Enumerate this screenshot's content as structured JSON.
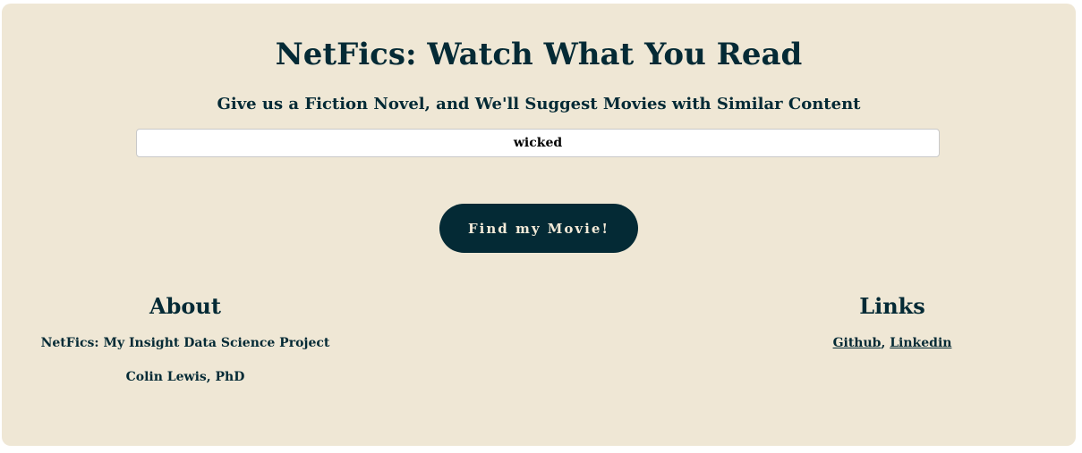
{
  "header": {
    "title": "NetFics: Watch What You Read",
    "subtitle": "Give us a Fiction Novel, and We'll Suggest Movies with Similar Content"
  },
  "search": {
    "value": "wicked",
    "placeholder": ""
  },
  "action": {
    "find_label": "Find my Movie!"
  },
  "footer": {
    "about": {
      "heading": "About",
      "project": "NetFics: My Insight Data Science Project",
      "author": "Colin Lewis, PhD"
    },
    "links": {
      "heading": "Links",
      "github": "Github",
      "separator": ", ",
      "linkedin": "Linkedin"
    }
  },
  "colors": {
    "panel_bg": "#efe7d5",
    "brand_dark": "#042a35",
    "button_text": "#f3ead8"
  }
}
